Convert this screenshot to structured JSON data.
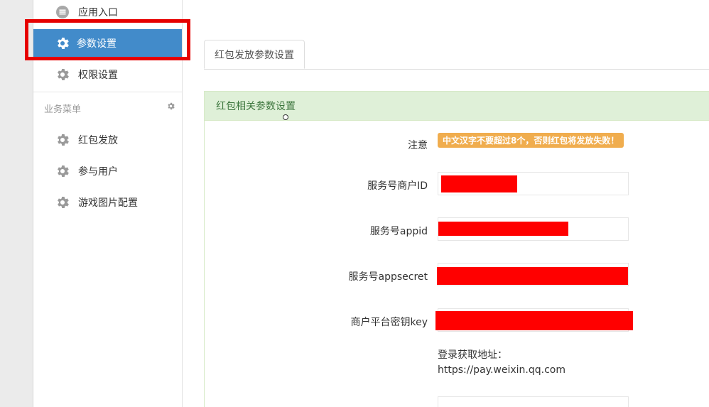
{
  "sidebar": {
    "items": [
      {
        "label": "应用入口",
        "icon": "list-icon"
      },
      {
        "label": "参数设置",
        "icon": "gear-icon",
        "active": true
      },
      {
        "label": "权限设置",
        "icon": "gear-icon"
      }
    ],
    "section_title": "业务菜单",
    "section_items": [
      {
        "label": "红包发放",
        "icon": "gear-icon"
      },
      {
        "label": "参与用户",
        "icon": "gear-icon"
      },
      {
        "label": "游戏图片配置",
        "icon": "gear-icon"
      }
    ]
  },
  "main": {
    "tab_label": "红包发放参数设置",
    "panel_title": "红包相关参数设置",
    "form": {
      "notice_label": "注意",
      "notice_badge": "中文汉字不要超过8个，否则红包将发放失败！",
      "merchant_id_label": "服务号商户ID",
      "appid_label": "服务号appid",
      "appsecret_label": "服务号appsecret",
      "key_label": "商户平台密钥key",
      "hint_line1": "登录获取地址：",
      "hint_line2": "https://pay.weixin.qq.com"
    }
  },
  "colors": {
    "active_nav": "#428bca",
    "highlight": "#e60000",
    "panel_head": "#dff0d8",
    "badge": "#f0ad4e",
    "redaction": "#ff0000"
  }
}
